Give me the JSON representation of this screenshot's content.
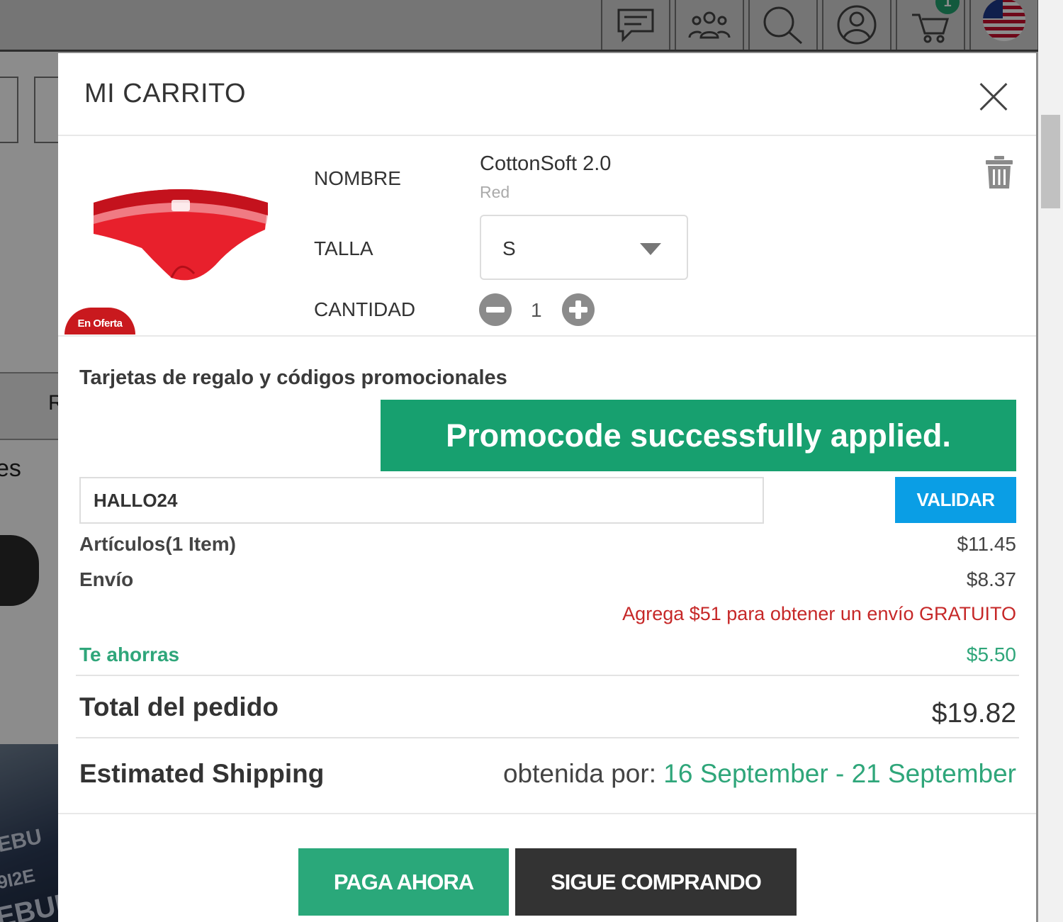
{
  "header_nav": {
    "icons": [
      "chat-icon",
      "community-icon",
      "search-icon",
      "account-icon",
      "cart-icon",
      "us-flag-icon"
    ],
    "cart_count": "1"
  },
  "background": {
    "fragment_a": "R",
    "fragment_b": "es",
    "banner_text_1": "EBU",
    "banner_text_2": "9I2E",
    "banner_text_3": "EBUN"
  },
  "modal": {
    "title": "MI CARRITO"
  },
  "cart_item": {
    "badge": "En Oferta",
    "labels": {
      "name": "NOMBRE",
      "size": "TALLA",
      "quantity": "CANTIDAD"
    },
    "name": "CottonSoft 2.0",
    "color": "Red",
    "size": "S",
    "quantity": "1"
  },
  "promo": {
    "title": "Tarjetas de regalo y códigos promocionales",
    "success_message": "Promocode successfully applied.",
    "code_value": "HALLO24",
    "validate_label": "VALIDAR"
  },
  "summary": {
    "items_label": "Artículos(1 Item)",
    "items_value": "$11.45",
    "shipping_label": "Envío",
    "shipping_value": "$8.37",
    "free_shipping_note": "Agrega $51 para obtener un envío GRATUITO",
    "savings_label": "Te ahorras",
    "savings_value": "$5.50",
    "total_label": "Total del pedido",
    "total_value": "$19.82",
    "estimated_label": "Estimated Shipping",
    "estimated_prefix": "obtenida por: ",
    "estimated_dates": "16 September - 21 September"
  },
  "actions": {
    "pay_now": "PAGA AHORA",
    "continue_shopping": "SIGUE COMPRANDO"
  },
  "colors": {
    "success_green": "#17a06f",
    "accent_green": "#2fa67a",
    "validate_blue": "#0a9ee5",
    "alert_red": "#c62828",
    "sale_red": "#c9191e",
    "dark_button": "#333333"
  }
}
